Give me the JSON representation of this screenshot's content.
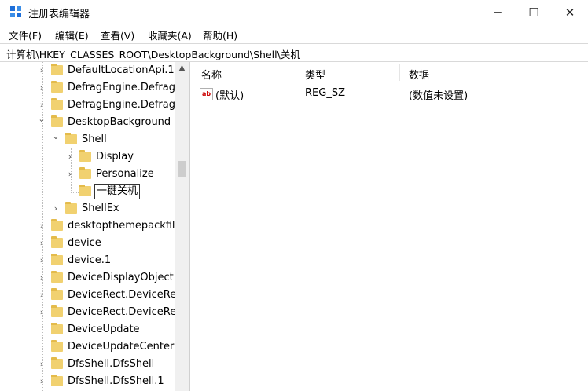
{
  "window": {
    "title": "注册表编辑器",
    "minimize_glyph": "─",
    "maximize_glyph": "☐",
    "close_glyph": "✕"
  },
  "menu": [
    "文件(F)",
    "编辑(E)",
    "查看(V)",
    "收藏夹(A)",
    "帮助(H)"
  ],
  "address": "计算机\\HKEY_CLASSES_ROOT\\DesktopBackground\\Shell\\关机",
  "tree": [
    {
      "label": "DefaultLocationApi.1",
      "level": 0,
      "expander": "collapsed"
    },
    {
      "label": "DefragEngine.Defrag",
      "level": 0,
      "expander": "collapsed"
    },
    {
      "label": "DefragEngine.Defrag",
      "level": 0,
      "expander": "collapsed"
    },
    {
      "label": "DesktopBackground",
      "level": 0,
      "expander": "expanded"
    },
    {
      "label": "Shell",
      "level": 1,
      "expander": "expanded"
    },
    {
      "label": "Display",
      "level": 2,
      "expander": "collapsed"
    },
    {
      "label": "Personalize",
      "level": 2,
      "expander": "collapsed"
    },
    {
      "label": "一键关机",
      "level": 2,
      "expander": "none",
      "editing": true
    },
    {
      "label": "ShellEx",
      "level": 1,
      "expander": "collapsed"
    },
    {
      "label": "desktopthemepackfil",
      "level": 0,
      "expander": "collapsed"
    },
    {
      "label": "device",
      "level": 0,
      "expander": "collapsed"
    },
    {
      "label": "device.1",
      "level": 0,
      "expander": "collapsed"
    },
    {
      "label": "DeviceDisplayObject",
      "level": 0,
      "expander": "collapsed"
    },
    {
      "label": "DeviceRect.DeviceRec",
      "level": 0,
      "expander": "collapsed"
    },
    {
      "label": "DeviceRect.DeviceRec",
      "level": 0,
      "expander": "collapsed"
    },
    {
      "label": "DeviceUpdate",
      "level": 0,
      "expander": "none"
    },
    {
      "label": "DeviceUpdateCenter",
      "level": 0,
      "expander": "none"
    },
    {
      "label": "DfsShell.DfsShell",
      "level": 0,
      "expander": "collapsed"
    },
    {
      "label": "DfsShell.DfsShell.1",
      "level": 0,
      "expander": "collapsed"
    }
  ],
  "list": {
    "columns": [
      "名称",
      "类型",
      "数据"
    ],
    "rows": [
      {
        "icon": "string-value-icon",
        "icon_text": "ab",
        "name": "(默认)",
        "type": "REG_SZ",
        "data": "(数值未设置)"
      }
    ]
  }
}
